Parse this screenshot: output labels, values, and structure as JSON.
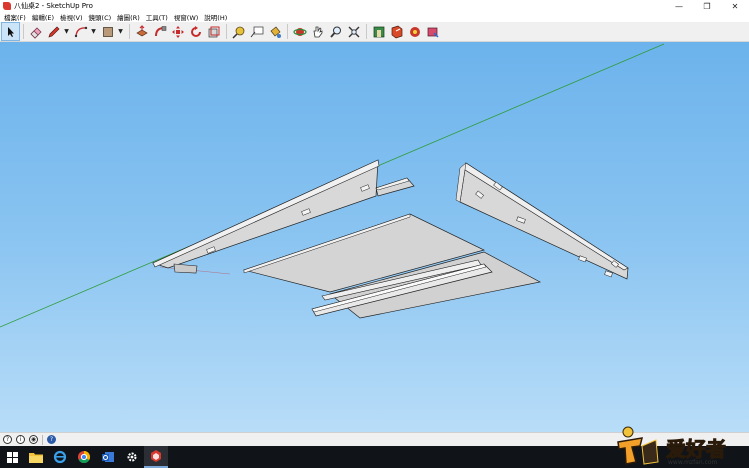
{
  "window": {
    "title": "八仙桌2 - SketchUp Pro",
    "minimize_glyph": "—",
    "maximize_glyph": "❐",
    "close_glyph": "✕"
  },
  "menu": {
    "items": [
      {
        "label": "檔案(F)"
      },
      {
        "label": "編輯(E)"
      },
      {
        "label": "檢視(V)"
      },
      {
        "label": "鏡頭(C)"
      },
      {
        "label": "繪圖(R)"
      },
      {
        "label": "工具(T)"
      },
      {
        "label": "視窗(W)"
      },
      {
        "label": "說明(H)"
      }
    ]
  },
  "toolbar": {
    "tools": [
      "select-tool",
      "eraser-tool",
      "line-tool",
      "arc-tool",
      "rectangle-tool",
      "push-pull-tool",
      "follow-me-tool",
      "move-tool",
      "rotate-tool",
      "scale-tool",
      "tape-measure-tool",
      "text-tool",
      "paint-bucket-tool",
      "orbit-tool",
      "pan-tool",
      "zoom-tool",
      "zoom-extents-tool",
      "3d-warehouse-tool",
      "extension-warehouse-tool",
      "layout-tool",
      "send-to-layout-tool"
    ],
    "selected_tool": "select-tool"
  },
  "viewport": {
    "sky_colors": [
      "#6cb3ec",
      "#b8ddf8"
    ],
    "green_axis_color": "#2e9c3a",
    "red_axis_color": "#c43a3a",
    "face_color": "#d6d6d6",
    "face_top_color": "#f1f1f1",
    "edge_color": "#222222"
  },
  "statusbar": {
    "icons": [
      "geo-location-icon",
      "credits-icon",
      "user-icon",
      "help-icon"
    ],
    "question_glyph": "?",
    "info_glyph": "i",
    "user_glyph": "◉",
    "help_glyph": "?"
  },
  "taskbar": {
    "items": [
      {
        "name": "start-button",
        "active": false
      },
      {
        "name": "file-explorer",
        "active": false
      },
      {
        "name": "internet-explorer",
        "active": false
      },
      {
        "name": "chrome",
        "active": false
      },
      {
        "name": "outlook",
        "active": false
      },
      {
        "name": "settings",
        "active": false
      },
      {
        "name": "sketchup",
        "active": true
      }
    ]
  },
  "watermark": {
    "brand_text": "爱好者",
    "url_text": "www.mzfan.com"
  }
}
